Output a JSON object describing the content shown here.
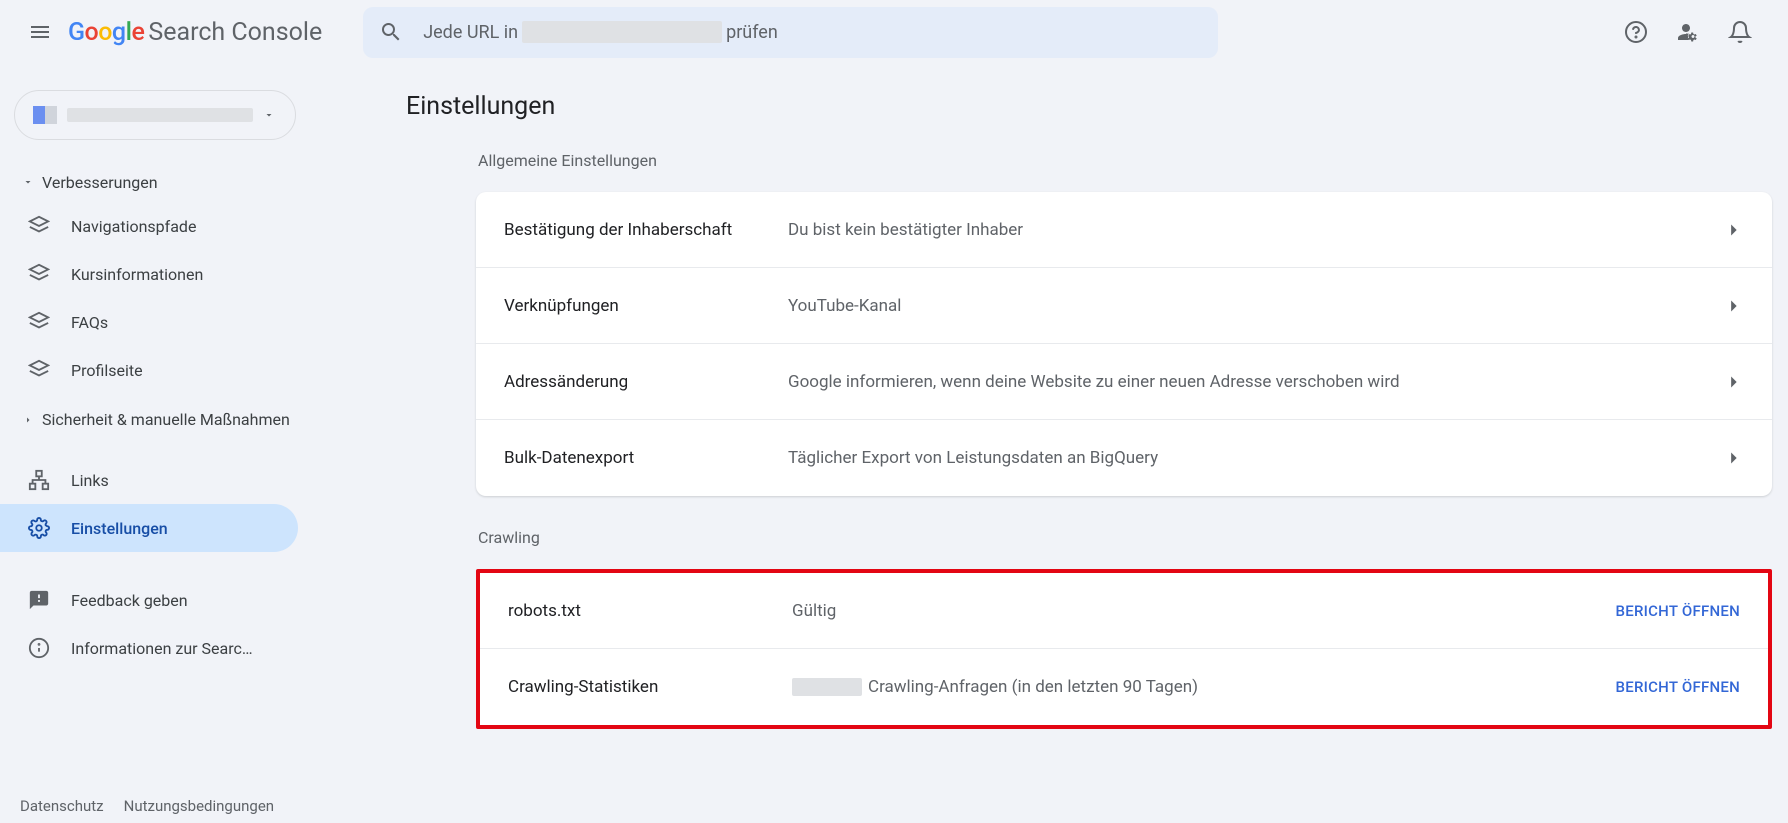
{
  "header": {
    "product_prefix": "Google",
    "product_name": "Search Console",
    "search_prefix": "Jede URL in",
    "search_suffix": "prüfen"
  },
  "sidebar": {
    "group_enh": "Verbesserungen",
    "nav_breadcrumbs": "Navigationspfade",
    "nav_courses": "Kursinformationen",
    "nav_faqs": "FAQs",
    "nav_profile": "Profilseite",
    "group_security": "Sicherheit & manuelle Maßnahmen",
    "nav_links": "Links",
    "nav_settings": "Einstellungen",
    "nav_feedback": "Feedback geben",
    "nav_info": "Informationen zur Searc…",
    "footer_privacy": "Datenschutz",
    "footer_terms": "Nutzungsbedingungen"
  },
  "main": {
    "title": "Einstellungen",
    "section_general": "Allgemeine Einstellungen",
    "rows_general": {
      "ownership_label": "Bestätigung der Inhaberschaft",
      "ownership_value": "Du bist kein bestätigter Inhaber",
      "assoc_label": "Verknüpfungen",
      "assoc_value": "YouTube-Kanal",
      "address_label": "Adressänderung",
      "address_value": "Google informieren, wenn deine Website zu einer neuen Adresse verschoben wird",
      "bulk_label": "Bulk-Datenexport",
      "bulk_value": "Täglicher Export von Leistungsdaten an BigQuery"
    },
    "section_crawling": "Crawling",
    "rows_crawling": {
      "robots_label": "robots.txt",
      "robots_value": "Gültig",
      "stats_label": "Crawling-Statistiken",
      "stats_value": "Crawling-Anfragen (in den letzten 90 Tagen)",
      "open_report": "BERICHT ÖFFNEN"
    }
  }
}
